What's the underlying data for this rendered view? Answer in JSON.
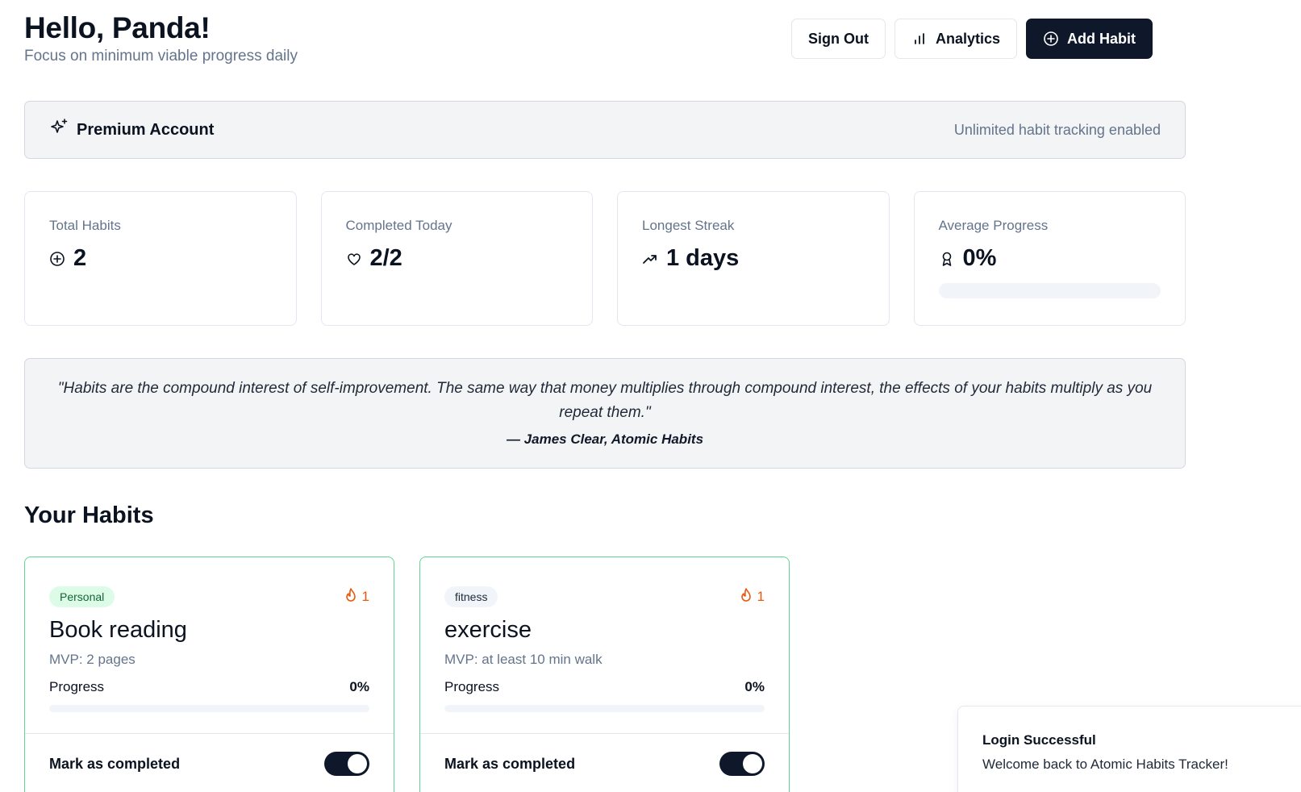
{
  "header": {
    "greeting": "Hello, Panda!",
    "subtitle": "Focus on minimum viable progress daily",
    "buttons": {
      "sign_out": "Sign Out",
      "analytics": "Analytics",
      "add_habit": "Add Habit"
    }
  },
  "premium": {
    "label": "Premium Account",
    "status": "Unlimited habit tracking enabled",
    "icon": "sparkles-icon"
  },
  "stats": [
    {
      "label": "Total Habits",
      "value": "2",
      "icon": "plus-circle-icon"
    },
    {
      "label": "Completed Today",
      "value": "2/2",
      "icon": "heart-icon"
    },
    {
      "label": "Longest Streak",
      "value": "1 days",
      "icon": "trending-up-icon"
    },
    {
      "label": "Average Progress",
      "value": "0%",
      "icon": "award-icon",
      "progress": 0
    }
  ],
  "quote": {
    "text": "\"Habits are the compound interest of self-improvement. The same way that money multiplies through compound interest, the effects of your habits multiply as you repeat them.\"",
    "author": "— James Clear, Atomic Habits"
  },
  "habits_section": {
    "title": "Your Habits",
    "progress_label": "Progress",
    "complete_label": "Mark as completed",
    "items": [
      {
        "category": "Personal",
        "streak": "1",
        "name": "Book reading",
        "mvp": "MVP: 2 pages",
        "progress": "0%",
        "progress_value": 0,
        "completed": true
      },
      {
        "category": "fitness",
        "streak": "1",
        "name": "exercise",
        "mvp": "MVP: at least 10 min walk",
        "progress": "0%",
        "progress_value": 0,
        "completed": true
      }
    ]
  },
  "toast": {
    "title": "Login Successful",
    "description": "Welcome back to Atomic Habits Tracker!"
  },
  "colors": {
    "primary": "#0f172a",
    "habit_border": "#5fd68f",
    "streak": "#ea580c",
    "muted": "#64748b"
  }
}
